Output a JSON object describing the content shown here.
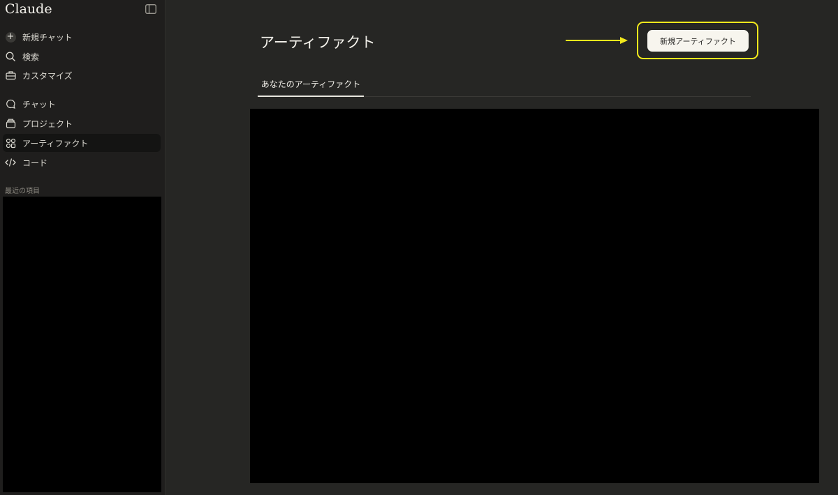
{
  "sidebar": {
    "brand": "Claude",
    "items": [
      {
        "label": "新規チャット",
        "icon": "plus-circle-icon"
      },
      {
        "label": "検索",
        "icon": "search-icon"
      },
      {
        "label": "カスタマイズ",
        "icon": "briefcase-icon"
      },
      {
        "label": "チャット",
        "icon": "chat-bubble-icon"
      },
      {
        "label": "プロジェクト",
        "icon": "folder-stack-icon"
      },
      {
        "label": "アーティファクト",
        "icon": "artifacts-grid-icon"
      },
      {
        "label": "コード",
        "icon": "code-icon"
      }
    ],
    "recent_label": "最近の項目"
  },
  "main": {
    "title": "アーティファクト",
    "new_button_label": "新規アーティファクト",
    "tabs": [
      {
        "label": "あなたのアーティファクト"
      }
    ]
  },
  "colors": {
    "background": "#262624",
    "sidebar_background": "#1f1e1d",
    "annotation_yellow": "#f2e81c",
    "button_background": "#f7f5ee"
  }
}
